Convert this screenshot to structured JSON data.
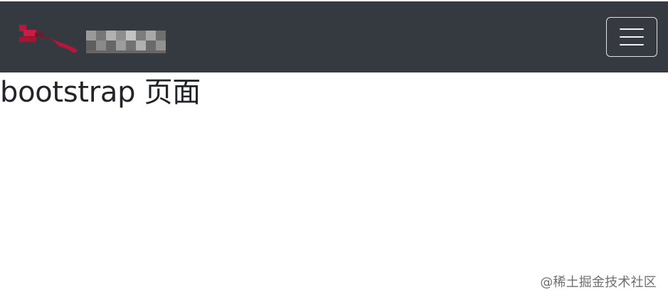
{
  "page": {
    "title": "bootstrap 页面"
  },
  "navbar": {
    "background_color": "#343a40",
    "brand_logo_icon": "blurred-brand-logo-icon",
    "toggle_icon": "hamburger-menu-icon"
  },
  "watermark": {
    "text": "@稀土掘金技术社区"
  }
}
